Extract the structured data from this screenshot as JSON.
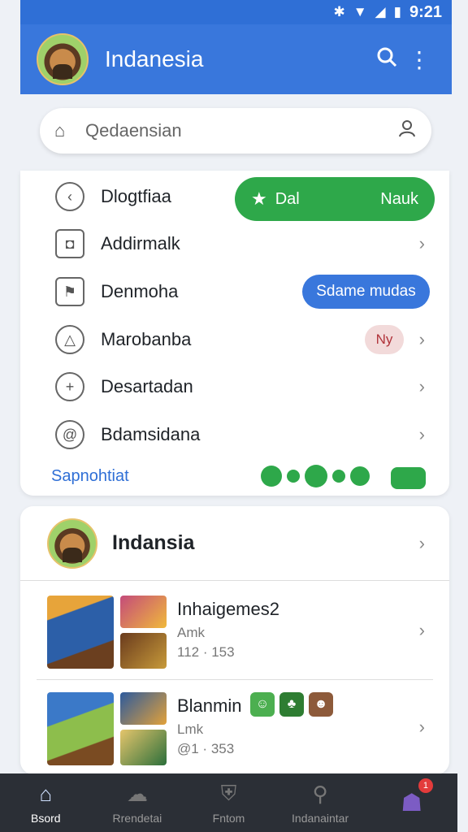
{
  "status_bar": {
    "time": "9:21",
    "icons": [
      "bluetooth-icon",
      "wifi-icon",
      "signal-icon",
      "battery-icon"
    ]
  },
  "app_bar": {
    "title": "Indanesia",
    "search_icon": "search-icon",
    "menu_icon": "more-vert-icon"
  },
  "search": {
    "value": "Qedaensian"
  },
  "menu": {
    "items": [
      {
        "label": "Dlogtfiaa",
        "icon": "back-circle-icon"
      },
      {
        "label": "Addirmalk",
        "icon": "camera-icon"
      },
      {
        "label": "Denmoha",
        "icon": "flag-icon"
      },
      {
        "label": "Marobanba",
        "icon": "triangle-icon"
      },
      {
        "label": "Desartadan",
        "icon": "plus-circle-icon"
      },
      {
        "label": "Bdamsidana",
        "icon": "at-icon"
      }
    ],
    "green_pill": {
      "left": "Dal",
      "right": "Nauk"
    },
    "blue_pill": "Sdame mudas",
    "badge": "Ny",
    "footer_link": "Sapnohtiat"
  },
  "profile": {
    "name": "Indansia",
    "games": [
      {
        "title": "Inhaigemes2",
        "subtitle": "Amk",
        "meta": "112 · 153"
      },
      {
        "title": "Blanmin",
        "subtitle": "Lmk",
        "meta": "@1 · 353"
      }
    ]
  },
  "bottom_nav": {
    "items": [
      {
        "label": "Bsord",
        "icon": "home-icon"
      },
      {
        "label": "Rrendetai",
        "icon": "chat-icon"
      },
      {
        "label": "Fntom",
        "icon": "shield-icon"
      },
      {
        "label": "Indanaintar",
        "icon": "search-icon"
      },
      {
        "label": "",
        "icon": "monster-icon"
      }
    ],
    "notification_count": "1"
  },
  "colors": {
    "primary": "#3977dc",
    "green": "#2ea84a",
    "badge_red": "#e33b3b",
    "nav_bg": "#2b2f36"
  }
}
